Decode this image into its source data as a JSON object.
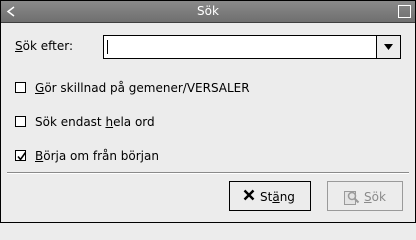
{
  "window": {
    "title": "Sök"
  },
  "search": {
    "label_underlined": "S",
    "label_rest": "ök efter:",
    "value": ""
  },
  "options": [
    {
      "pre": "",
      "accel": "G",
      "post": "ör skillnad på gemener/VERSALER",
      "checked": false
    },
    {
      "pre": "Sök endast ",
      "accel": "h",
      "post": "ela ord",
      "checked": false
    },
    {
      "pre": "",
      "accel": "B",
      "post": "örja om från början",
      "checked": true
    }
  ],
  "buttons": {
    "close": {
      "pre": "St",
      "accel": "ä",
      "post": "ng"
    },
    "search": {
      "pre": "",
      "accel": "S",
      "post": "ök"
    }
  }
}
